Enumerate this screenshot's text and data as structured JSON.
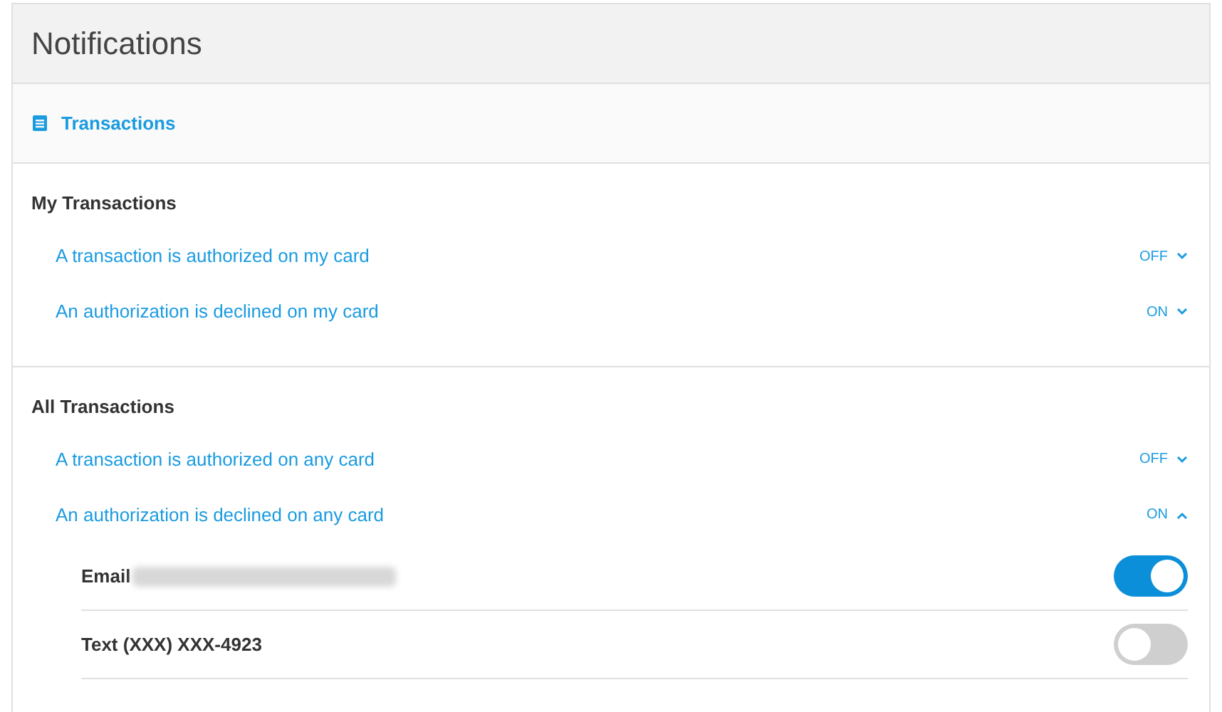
{
  "header": {
    "title": "Notifications"
  },
  "category": {
    "label": "Transactions"
  },
  "sections": [
    {
      "title": "My Transactions",
      "rows": [
        {
          "label": "A transaction is authorized on my card",
          "status": "OFF",
          "expanded": false
        },
        {
          "label": "An authorization is declined on my card",
          "status": "ON",
          "expanded": false
        }
      ]
    },
    {
      "title": "All Transactions",
      "rows": [
        {
          "label": "A transaction is authorized on any card",
          "status": "OFF",
          "expanded": false
        },
        {
          "label": "An authorization is declined on any card",
          "status": "ON",
          "expanded": true,
          "channels": [
            {
              "label": "Email",
              "redacted": true,
              "on": true
            },
            {
              "label": "Text (XXX) XXX-4923",
              "redacted": false,
              "on": false
            }
          ]
        }
      ]
    }
  ]
}
